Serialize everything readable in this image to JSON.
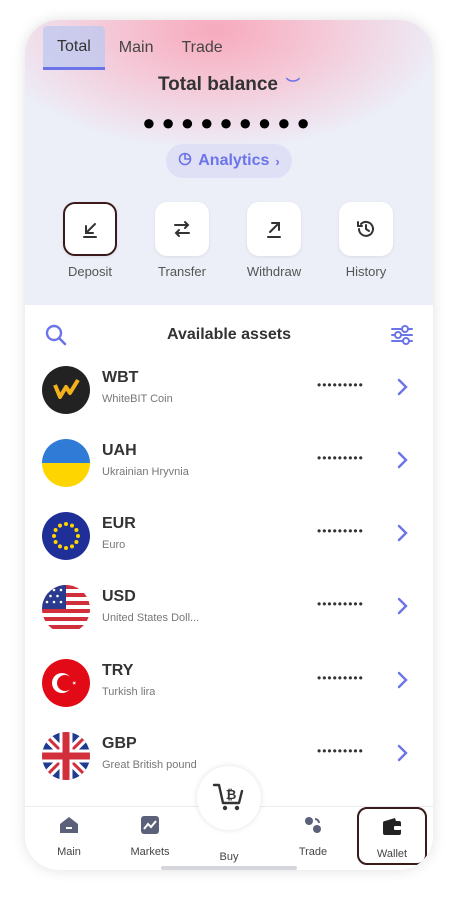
{
  "tabs": [
    {
      "label": "Total",
      "active": true
    },
    {
      "label": "Main",
      "active": false
    },
    {
      "label": "Trade",
      "active": false
    }
  ],
  "balance": {
    "title": "Total balance",
    "value": "●●●●●●●●●",
    "analytics_label": "Analytics"
  },
  "actions": [
    {
      "label": "Deposit",
      "icon": "arrow-down-left-icon"
    },
    {
      "label": "Transfer",
      "icon": "swap-arrows-icon"
    },
    {
      "label": "Withdraw",
      "icon": "arrow-up-right-icon"
    },
    {
      "label": "History",
      "icon": "history-clock-icon"
    }
  ],
  "assets_title": "Available assets",
  "assets": [
    {
      "symbol": "WBT",
      "name": "WhiteBIT Coin",
      "amount": "•••••••••"
    },
    {
      "symbol": "UAH",
      "name": "Ukrainian Hryvnia",
      "amount": "•••••••••"
    },
    {
      "symbol": "EUR",
      "name": "Euro",
      "amount": "•••••••••"
    },
    {
      "symbol": "USD",
      "name": "United States Doll...",
      "amount": "•••••••••"
    },
    {
      "symbol": "TRY",
      "name": "Turkish lira",
      "amount": "•••••••••"
    },
    {
      "symbol": "GBP",
      "name": "Great British pound",
      "amount": "•••••••••"
    }
  ],
  "nav": [
    {
      "label": "Main",
      "icon": "home-icon"
    },
    {
      "label": "Markets",
      "icon": "chart-icon"
    },
    {
      "label": "Buy",
      "icon": "cart-icon"
    },
    {
      "label": "Trade",
      "icon": "trade-icon"
    },
    {
      "label": "Wallet",
      "icon": "wallet-icon"
    }
  ],
  "colors": {
    "accent": "#6b74e8",
    "selected_border": "#3a1a1a"
  }
}
